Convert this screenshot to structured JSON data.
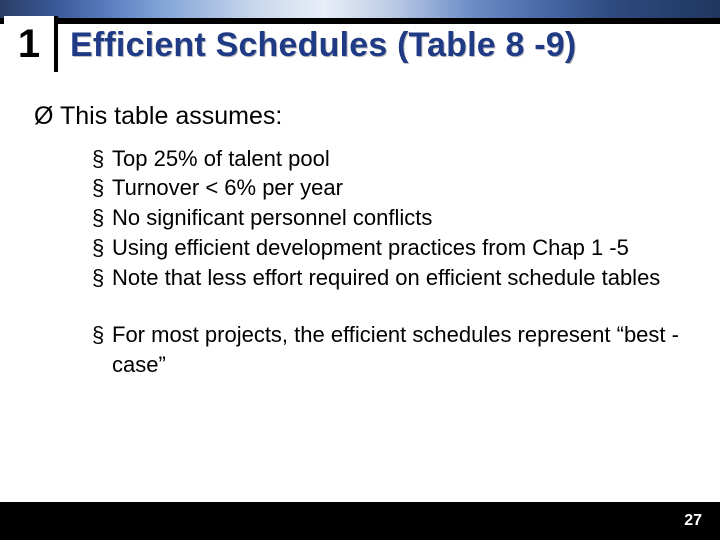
{
  "slide_badge": "1",
  "title": "Efficient Schedules (Table 8 -9)",
  "bullets_lvl1": [
    {
      "marker": "Ø",
      "text": "This table assumes:"
    }
  ],
  "bullets_lvl2_group1": [
    {
      "marker": "§",
      "text": "Top 25% of talent pool"
    },
    {
      "marker": "§",
      "text": "Turnover < 6% per year"
    },
    {
      "marker": "§",
      "text": "No significant personnel conflicts"
    },
    {
      "marker": "§",
      "text": "Using efficient development practices from Chap 1 -5"
    },
    {
      "marker": "§",
      "text": "Note that less effort required on efficient schedule tables"
    }
  ],
  "bullets_lvl2_group2": [
    {
      "marker": "§",
      "text": "For most projects, the efficient schedules represent “best -case”"
    }
  ],
  "page_number": "27"
}
